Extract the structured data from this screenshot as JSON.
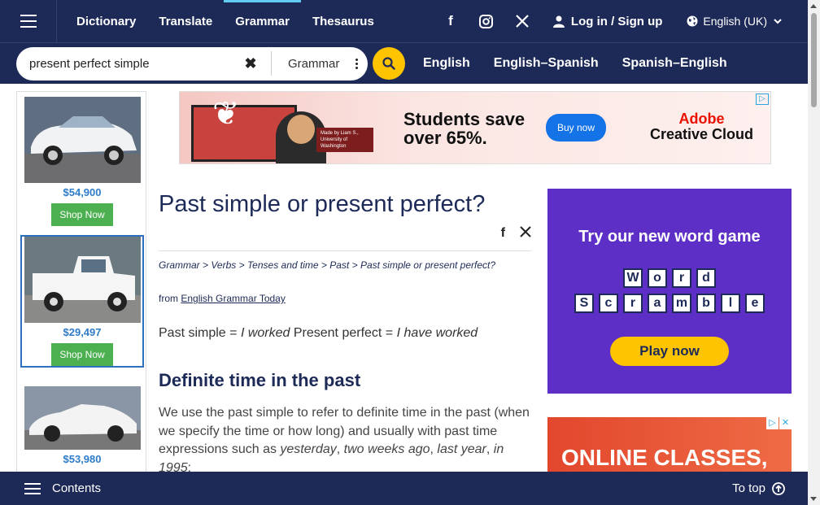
{
  "nav": {
    "links": [
      "Dictionary",
      "Translate",
      "Grammar",
      "Thesaurus"
    ],
    "login": "Log in / Sign up",
    "language": "English (UK)"
  },
  "search": {
    "value": "present perfect simple",
    "dictionary": "Grammar",
    "dict_links": [
      "English",
      "English–Spanish",
      "Spanish–English"
    ]
  },
  "left_ads": {
    "prices": [
      "$54,900",
      "$29,497",
      "$53,980"
    ],
    "shop_label": "Shop Now"
  },
  "banner": {
    "headline_line1": "Students save",
    "headline_line2": "over 65%.",
    "buy_label": "Buy now",
    "brand_line1": "Adobe",
    "brand_line2": "Creative Cloud",
    "tag_line1": "Made by Liam S.,",
    "tag_line2": "University of Washington"
  },
  "article": {
    "title": "Past simple or present perfect?",
    "breadcrumb": [
      "Grammar",
      "Verbs",
      "Tenses and time",
      "Past",
      "Past simple or present perfect?"
    ],
    "from_label": "from",
    "from_link": "English Grammar Today",
    "summary": {
      "a": "Past simple = ",
      "b": "I worked",
      "c": " Present perfect = ",
      "d": "I have worked"
    },
    "section_heading": "Definite time in the past",
    "para": {
      "a": "We use the past simple to refer to definite time in the past (when we specify the time or how long) and usually with past time expressions such as ",
      "b": "yesterday",
      "c": ", ",
      "d": "two weeks ago",
      "e": ", ",
      "f": "last year",
      "g": ", ",
      "h": "in 1995",
      "i": ":"
    }
  },
  "word_ad": {
    "heading": "Try our new word game",
    "row1": [
      "W",
      "o",
      "r",
      "d"
    ],
    "row2": [
      "S",
      "c",
      "r",
      "a",
      "m",
      "b",
      "l",
      "e"
    ],
    "button": "Play now"
  },
  "class_ad": {
    "text": "ONLINE CLASSES,"
  },
  "bottom": {
    "contents": "Contents",
    "to_top": "To top"
  }
}
